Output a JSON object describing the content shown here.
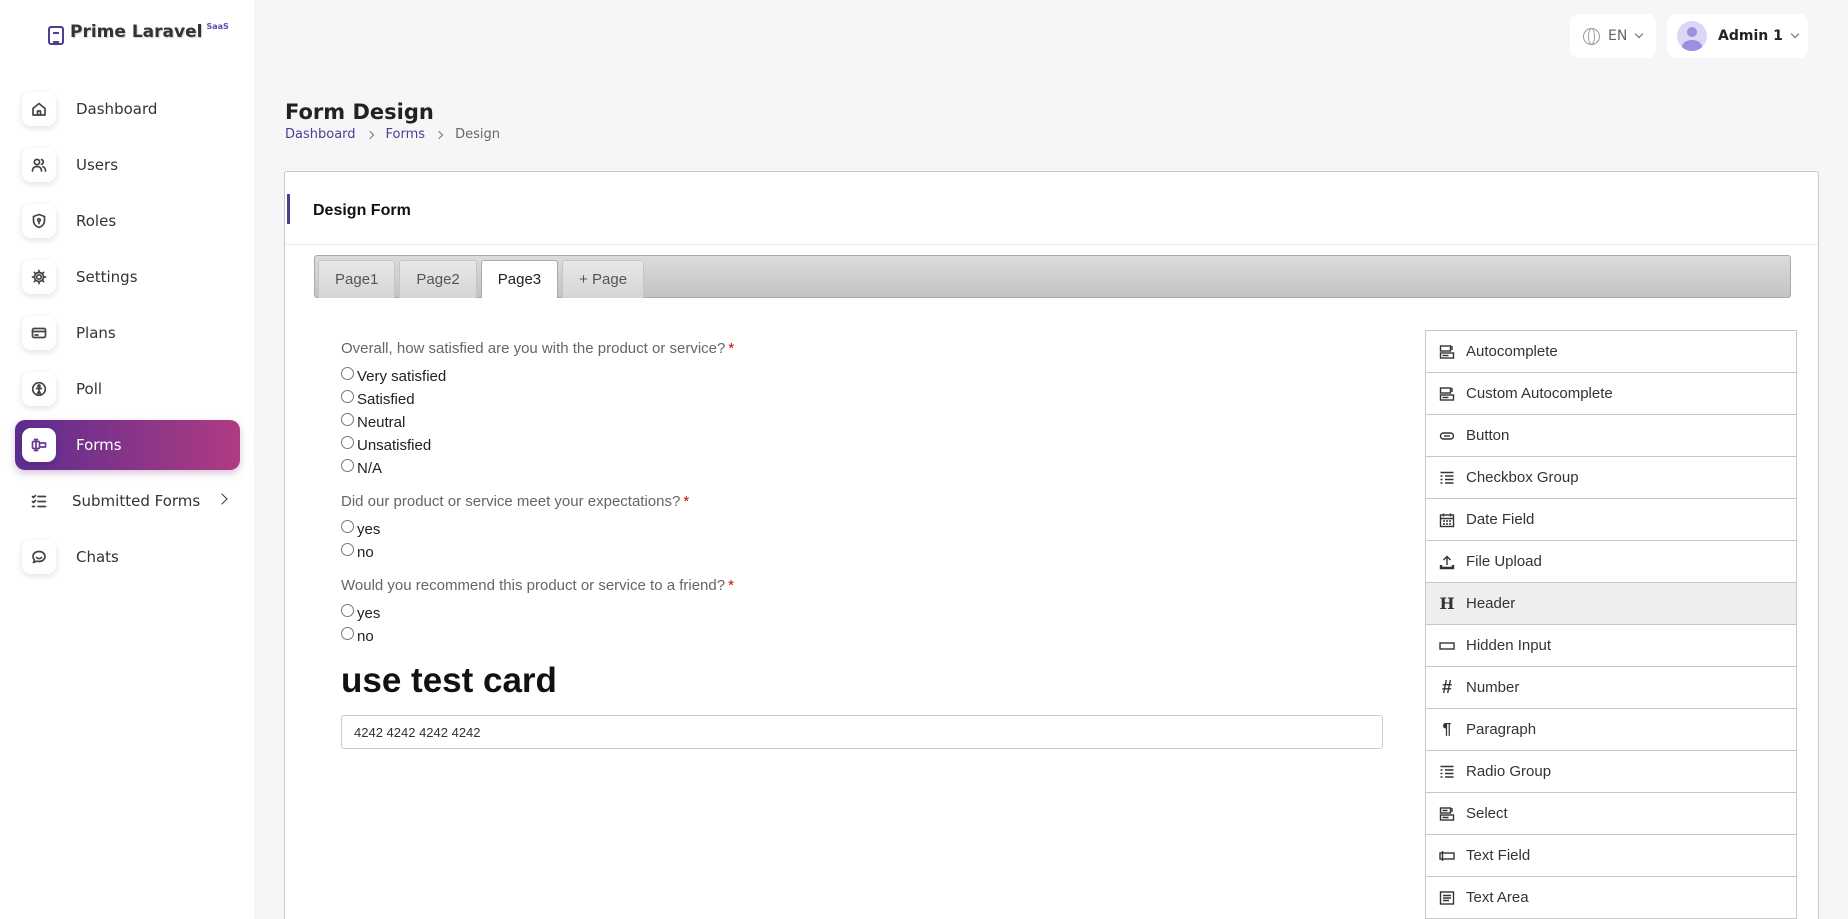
{
  "app": {
    "logo_text": "Prime Laravel",
    "logo_badge": "SaaS"
  },
  "sidebar": {
    "items": [
      {
        "label": "Dashboard",
        "icon": "home-icon"
      },
      {
        "label": "Users",
        "icon": "users-icon"
      },
      {
        "label": "Roles",
        "icon": "shield-icon"
      },
      {
        "label": "Settings",
        "icon": "gear-icon"
      },
      {
        "label": "Plans",
        "icon": "card-icon"
      },
      {
        "label": "Poll",
        "icon": "poll-icon"
      },
      {
        "label": "Forms",
        "icon": "forms-icon",
        "active": true
      },
      {
        "label": "Submitted Forms",
        "icon": "list-check-icon",
        "has_children": true
      },
      {
        "label": "Chats",
        "icon": "chat-icon"
      }
    ]
  },
  "topbar": {
    "language": "EN",
    "user_name": "Admin 1"
  },
  "page": {
    "title": "Form Design",
    "breadcrumb": [
      "Dashboard",
      "Forms",
      "Design"
    ]
  },
  "card": {
    "title": "Design Form",
    "tabs": [
      "Page1",
      "Page2",
      "Page3",
      "+ Page"
    ],
    "active_tab": "Page3"
  },
  "form": {
    "questions": [
      {
        "label": "Overall, how satisfied are you with the product or service?",
        "required_mark": "*",
        "options": [
          "Very satisfied",
          "Satisfied",
          "Neutral",
          "Unsatisfied",
          "N/A"
        ]
      },
      {
        "label": "Did our product or service meet your expectations?",
        "required_mark": "*",
        "options": [
          "yes",
          "no"
        ]
      },
      {
        "label": "Would you recommend this product or service to a friend?",
        "required_mark": "*",
        "options": [
          "yes",
          "no"
        ]
      }
    ],
    "header_text": "use test card",
    "text_field_value": "4242 4242 4242 4242"
  },
  "controls": [
    {
      "label": "Autocomplete",
      "icon": "autocomplete-icon"
    },
    {
      "label": "Custom Autocomplete",
      "icon": "autocomplete-icon"
    },
    {
      "label": "Button",
      "icon": "button-icon"
    },
    {
      "label": "Checkbox Group",
      "icon": "checkbox-group-icon"
    },
    {
      "label": "Date Field",
      "icon": "calendar-icon"
    },
    {
      "label": "File Upload",
      "icon": "upload-icon"
    },
    {
      "label": "Header",
      "icon": "header-icon",
      "hover": true
    },
    {
      "label": "Hidden Input",
      "icon": "hidden-input-icon"
    },
    {
      "label": "Number",
      "icon": "hash-icon"
    },
    {
      "label": "Paragraph",
      "icon": "paragraph-icon"
    },
    {
      "label": "Radio Group",
      "icon": "radio-group-icon"
    },
    {
      "label": "Select",
      "icon": "select-icon"
    },
    {
      "label": "Text Field",
      "icon": "text-field-icon"
    },
    {
      "label": "Text Area",
      "icon": "text-area-icon"
    }
  ],
  "colors": {
    "accent": "#4c3f91",
    "active_gradient_start": "#5b2d8f",
    "active_gradient_end": "#b03b82",
    "required": "#cc0000"
  }
}
